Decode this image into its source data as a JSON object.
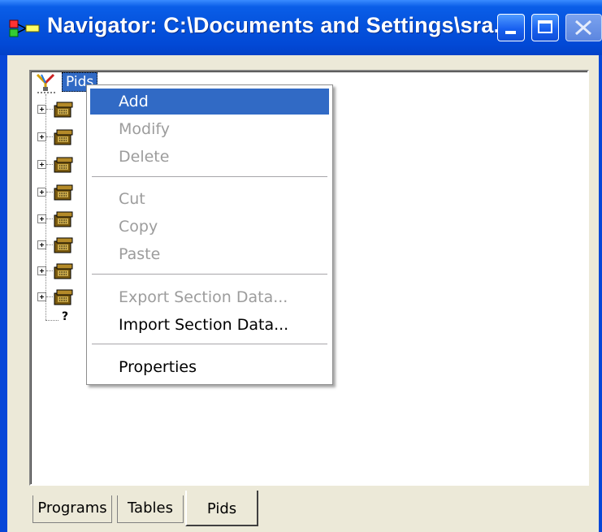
{
  "window": {
    "title": "Navigator: C:\\Documents and Settings\\sra...",
    "minimize_label": "",
    "maximize_label": "",
    "close_label": ""
  },
  "tree": {
    "root_label": "Pids",
    "nodes": [
      "",
      "",
      "",
      "",
      "",
      "",
      "",
      ""
    ],
    "unknown_node_label": "?"
  },
  "context_menu": {
    "items": [
      {
        "label": "Add",
        "enabled": true,
        "selected": true
      },
      {
        "label": "Modify",
        "enabled": false
      },
      {
        "label": "Delete",
        "enabled": false
      },
      {
        "label": "Cut",
        "enabled": false
      },
      {
        "label": "Copy",
        "enabled": false
      },
      {
        "label": "Paste",
        "enabled": false
      },
      {
        "label": "Export Section Data...",
        "enabled": false
      },
      {
        "label": "Import Section Data...",
        "enabled": true
      },
      {
        "label": "Properties",
        "enabled": true
      }
    ]
  },
  "tabs": [
    {
      "label": "Programs",
      "active": false
    },
    {
      "label": "Tables",
      "active": false
    },
    {
      "label": "Pids",
      "active": true
    }
  ],
  "colors": {
    "titlebar": "#0553dd",
    "selection": "#316ac5",
    "disabled_text": "#9c9c9c"
  },
  "icons": {
    "app": "navigator-app-icon",
    "root": "pid-root-icon",
    "node": "folder-cabinet-icon"
  }
}
